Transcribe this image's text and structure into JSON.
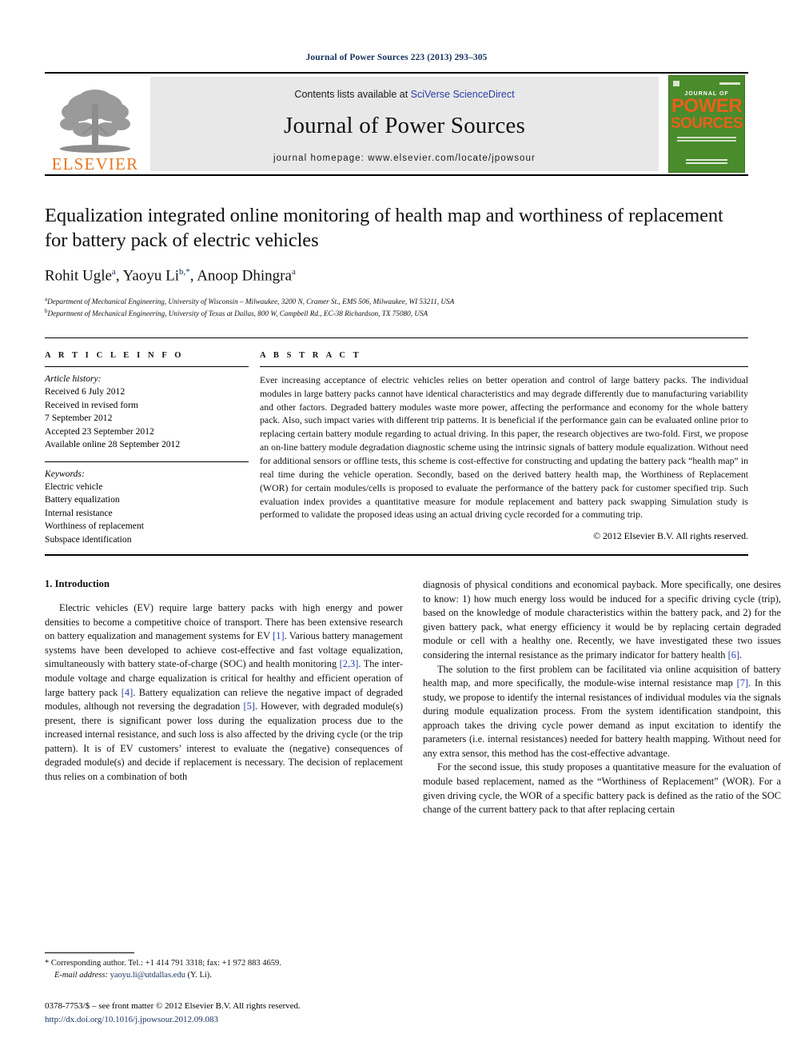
{
  "running_head": "Journal of Power Sources 223 (2013) 293–305",
  "masthead": {
    "publisher_wordmark": "ELSEVIER",
    "contents_prefix": "Contents lists available at ",
    "contents_link": "SciVerse ScienceDirect",
    "journal_title": "Journal of Power Sources",
    "homepage": "journal homepage: www.elsevier.com/locate/jpowsour",
    "cover": {
      "line1": "JOURNAL OF",
      "line2": "POWER",
      "line3": "SOURCES",
      "background_color": "#4a8b2c",
      "text_color": "#E8601C"
    }
  },
  "article": {
    "title": "Equalization integrated online monitoring of health map and worthiness of replacement for battery pack of electric vehicles",
    "authors": [
      {
        "name": "Rohit Ugle",
        "marks": "a"
      },
      {
        "name": "Yaoyu Li",
        "marks": "b,*"
      },
      {
        "name": "Anoop Dhingra",
        "marks": "a"
      }
    ],
    "affiliations": [
      {
        "mark": "a",
        "text": "Department of Mechanical Engineering, University of Wisconsin – Milwaukee, 3200 N, Cramer St., EMS 506, Milwaukee, WI 53211, USA"
      },
      {
        "mark": "b",
        "text": "Department of Mechanical Engineering, University of Texas at Dallas, 800 W, Campbell Rd., EC-38 Richardson, TX 75080, USA"
      }
    ]
  },
  "info": {
    "heading": "A R T I C L E  I N F O",
    "history_label": "Article history:",
    "history": [
      "Received 6 July 2012",
      "Received in revised form",
      "7 September 2012",
      "Accepted 23 September 2012",
      "Available online 28 September 2012"
    ],
    "keywords_label": "Keywords:",
    "keywords": [
      "Electric vehicle",
      "Battery equalization",
      "Internal resistance",
      "Worthiness of replacement",
      "Subspace identification"
    ]
  },
  "abstract": {
    "heading": "A B S T R A C T",
    "text": "Ever increasing acceptance of electric vehicles relies on better operation and control of large battery packs. The individual modules in large battery packs cannot have identical characteristics and may degrade differently due to manufacturing variability and other factors. Degraded battery modules waste more power, affecting the performance and economy for the whole battery pack. Also, such impact varies with different trip patterns. It is beneficial if the performance gain can be evaluated online prior to replacing certain battery module regarding to actual driving. In this paper, the research objectives are two-fold. First, we propose an on-line battery module degradation diagnostic scheme using the intrinsic signals of battery module equalization. Without need for additional sensors or offline tests, this scheme is cost-effective for constructing and updating the battery pack “health map” in real time during the vehicle operation. Secondly, based on the derived battery health map, the Worthiness of Replacement (WOR) for certain modules/cells is proposed to evaluate the performance of the battery pack for customer specified trip. Such evaluation index provides a quantitative measure for module replacement and battery pack swapping Simulation study is performed to validate the proposed ideas using an actual driving cycle recorded for a commuting trip.",
    "copyright": "© 2012 Elsevier B.V. All rights reserved."
  },
  "introduction": {
    "heading": "1.  Introduction",
    "left_paragraphs": [
      "Electric vehicles (EV) require large battery packs with high energy and power densities to become a competitive choice of transport. There has been extensive research on battery equalization and management systems for EV [1]. Various battery management systems have been developed to achieve cost-effective and fast voltage equalization, simultaneously with battery state-of-charge (SOC) and health monitoring [2,3]. The inter-module voltage and charge equalization is critical for healthy and efficient operation of large battery pack [4]. Battery equalization can relieve the negative impact of degraded modules, although not reversing the degradation [5]. However, with degraded module(s) present, there is significant power loss during the equalization process due to the increased internal resistance, and such loss is also affected by the driving cycle (or the trip pattern). It is of EV customers’ interest to evaluate the (negative) consequences of degraded module(s) and decide if replacement is necessary. The decision of replacement thus relies on a combination of both"
    ],
    "right_paragraphs": [
      "diagnosis of physical conditions and economical payback. More specifically, one desires to know: 1) how much energy loss would be induced for a specific driving cycle (trip), based on the knowledge of module characteristics within the battery pack, and 2) for the given battery pack, what energy efficiency it would be by replacing certain degraded module or cell with a healthy one. Recently, we have investigated these two issues considering the internal resistance as the primary indicator for battery health [6].",
      "The solution to the first problem can be facilitated via online acquisition of battery health map, and more specifically, the module-wise internal resistance map [7]. In this study, we propose to identify the internal resistances of individual modules via the signals during module equalization process. From the system identification standpoint, this approach takes the driving cycle power demand as input excitation to identify the parameters (i.e. internal resistances) needed for battery health mapping. Without need for any extra sensor, this method has the cost-effective advantage.",
      "For the second issue, this study proposes a quantitative measure for the evaluation of module based replacement, named as the “Worthiness of Replacement” (WOR). For a given driving cycle, the WOR of a specific battery pack is defined as the ratio of the SOC change of the current battery pack to that after replacing certain"
    ]
  },
  "footnotes": {
    "corresponding": "* Corresponding author. Tel.: +1 414 791 3318; fax: +1 972 883 4659.",
    "email_label": "E-mail address:",
    "email": "yaoyu.li@utdallas.edu",
    "email_suffix": "(Y. Li).",
    "issn_line": "0378-7753/$ – see front matter © 2012 Elsevier B.V. All rights reserved.",
    "doi": "http://dx.doi.org/10.1016/j.jpowsour.2012.09.083"
  },
  "colors": {
    "link_blue": "#2b3ea8",
    "dark_blue": "#16315e",
    "elsevier_orange": "#E87722",
    "cover_green": "#4a8b2c"
  }
}
